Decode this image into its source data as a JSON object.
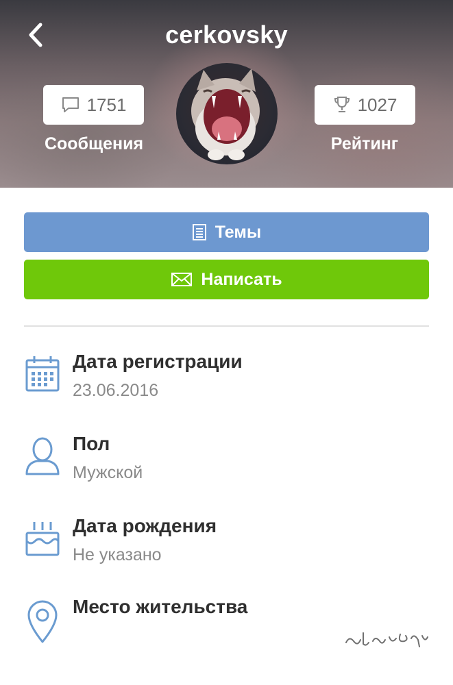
{
  "header": {
    "username": "cerkovsky",
    "messages": {
      "count": "1751",
      "label": "Сообщения",
      "icon": "speech-bubble-icon"
    },
    "rating": {
      "count": "1027",
      "label": "Рейтинг",
      "icon": "trophy-icon"
    },
    "avatar_desc": "screaming-cat"
  },
  "actions": {
    "topics_label": "Темы",
    "write_label": "Написать"
  },
  "info": [
    {
      "label": "Дата регистрации",
      "value": "23.06.2016",
      "icon": "calendar-icon"
    },
    {
      "label": "Пол",
      "value": "Мужской",
      "icon": "user-icon"
    },
    {
      "label": "Дата рождения",
      "value": "Не указано",
      "icon": "birthday-cake-icon"
    },
    {
      "label": "Место жительства",
      "value": "",
      "icon": "location-pin-icon"
    }
  ],
  "colors": {
    "topics_button": "#6d98d0",
    "write_button": "#6fc80a",
    "icon_blue": "#6a9bd0"
  }
}
